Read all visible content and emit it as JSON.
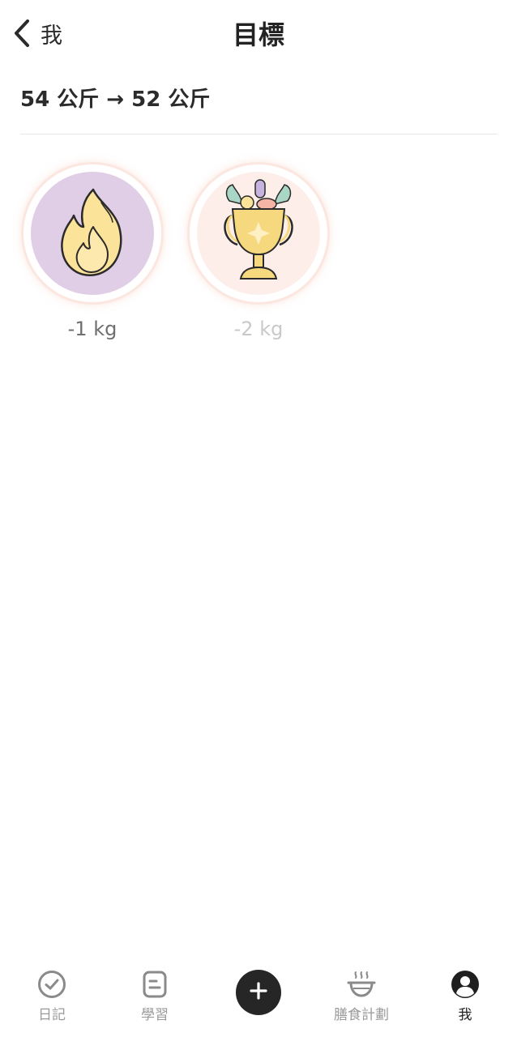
{
  "header": {
    "back_label": "我",
    "title": "目標"
  },
  "goal": {
    "summary": "54 公斤 → 52 公斤"
  },
  "badges": [
    {
      "label": "-1 kg",
      "icon": "flame-icon",
      "achieved": true
    },
    {
      "label": "-2 kg",
      "icon": "trophy-icon",
      "achieved": false
    }
  ],
  "nav": {
    "items": [
      {
        "label": "日記",
        "icon": "check-circle-icon"
      },
      {
        "label": "學習",
        "icon": "document-icon"
      },
      {
        "label": "",
        "icon": "plus-icon"
      },
      {
        "label": "膳食計劃",
        "icon": "bowl-icon"
      },
      {
        "label": "我",
        "icon": "user-icon"
      }
    ],
    "active_index": 4
  },
  "colors": {
    "badge_achieved_bg": "#e0cde6",
    "badge_locked_bg": "#fdeee9",
    "flame_fill": "#fbe399",
    "trophy_fill": "#f6d87f",
    "add_button": "#262626"
  }
}
